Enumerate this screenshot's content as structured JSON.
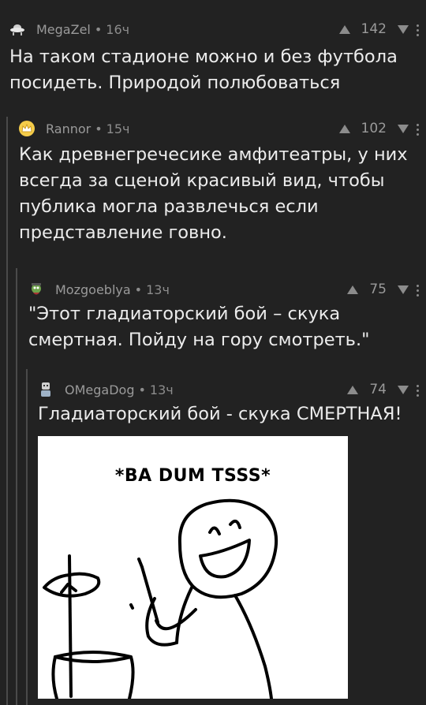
{
  "comments": [
    {
      "author": "MegaZel",
      "time": "16ч",
      "votes": "142",
      "avatar_icon": "ufo-avatar-icon",
      "text": "На таком стадионе можно и без футбола посидеть. Природой полюбоваться"
    },
    {
      "author": "Rannor",
      "time": "15ч",
      "votes": "102",
      "avatar_icon": "crown-avatar-icon",
      "text": "Как древнегречесике амфитеатры, у них всегда за сценой красивый вид, чтобы публика могла развлечься если представление говно."
    },
    {
      "author": "Mozgoeblya",
      "time": "13ч",
      "votes": "75",
      "avatar_icon": "character-avatar-icon",
      "text": "\"Этот гладиаторский бой – скука смертная. Пойду на гору смотреть.\""
    },
    {
      "author": "OMegaDog",
      "time": "13ч",
      "votes": "74",
      "avatar_icon": "robot-avatar-icon",
      "text": "Гладиаторский бой - скука СМЕРТНАЯ!"
    }
  ],
  "separator": "•",
  "meme": {
    "caption": "*BA DUM TSSS*"
  },
  "colors": {
    "background": "#222222",
    "text": "#ececec",
    "meta": "#8c8c8c",
    "thread_line": "#4a4a4a"
  }
}
